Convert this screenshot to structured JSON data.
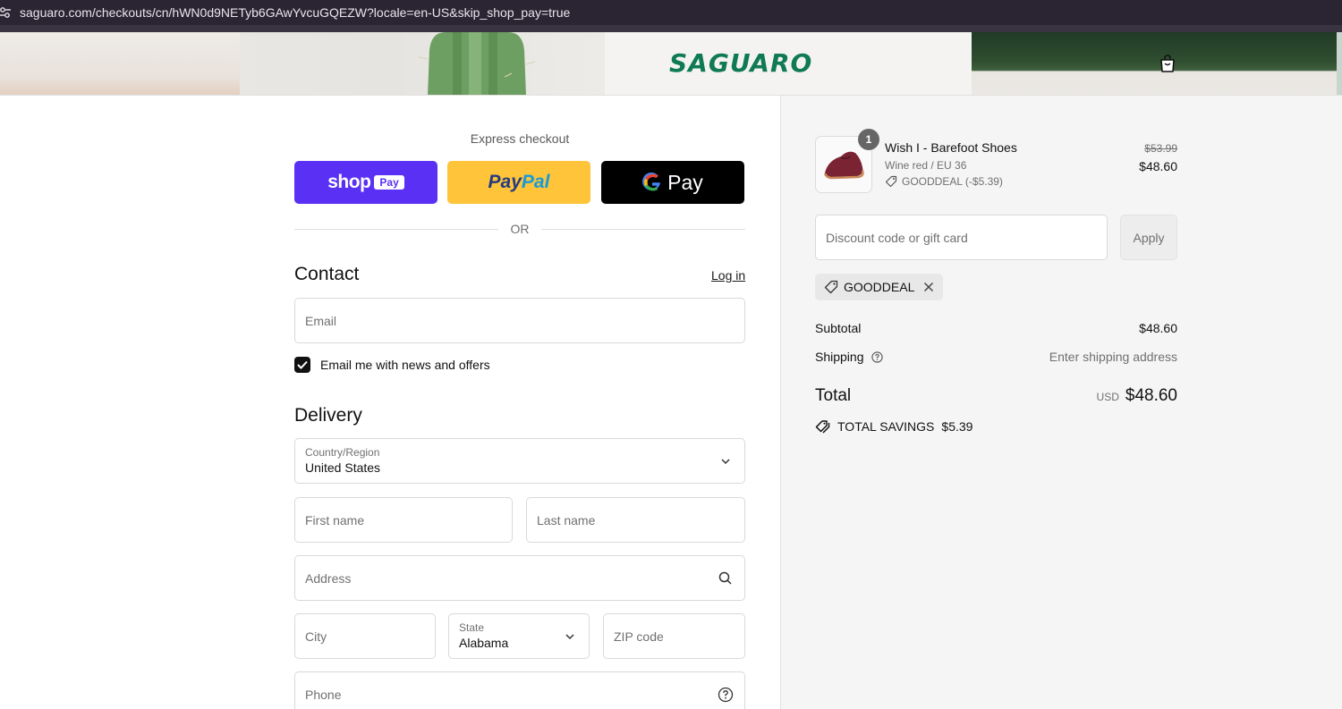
{
  "browser": {
    "url": "saguaro.com/checkouts/cn/hWN0d9NETyb6GAwYvcuGQEZW?locale=en-US&skip_shop_pay=true"
  },
  "header": {
    "logo_text": "SAGUARO",
    "brand_color": "#0f7a55"
  },
  "express": {
    "title": "Express checkout",
    "shop_pay": {
      "word": "shop",
      "badge": "Pay",
      "color": "#5a31f4"
    },
    "paypal": {
      "part1": "Pay",
      "part2": "Pal",
      "color": "#ffc439"
    },
    "gpay": {
      "word": "Pay"
    },
    "separator": "OR"
  },
  "contact": {
    "heading": "Contact",
    "login_link": "Log in",
    "email_placeholder": "Email",
    "newsletter_label": "Email me with news and offers",
    "newsletter_checked": true
  },
  "delivery": {
    "heading": "Delivery",
    "country_label": "Country/Region",
    "country_value": "United States",
    "first_name_placeholder": "First name",
    "last_name_placeholder": "Last name",
    "address_placeholder": "Address",
    "city_placeholder": "City",
    "state_label": "State",
    "state_value": "Alabama",
    "zip_placeholder": "ZIP code",
    "phone_placeholder": "Phone"
  },
  "summary": {
    "item": {
      "quantity": "1",
      "name": "Wish I - Barefoot Shoes",
      "variant": "Wine red / EU 36",
      "discount": "GOODDEAL (-$5.39)",
      "original_price": "$53.99",
      "price": "$48.60"
    },
    "discount_placeholder": "Discount code or gift card",
    "apply_label": "Apply",
    "applied_code": "GOODDEAL",
    "subtotal_label": "Subtotal",
    "subtotal_value": "$48.60",
    "shipping_label": "Shipping",
    "shipping_value": "Enter shipping address",
    "total_label": "Total",
    "total_currency": "USD",
    "total_value": "$48.60",
    "savings_label": "TOTAL SAVINGS",
    "savings_value": "$5.39"
  }
}
